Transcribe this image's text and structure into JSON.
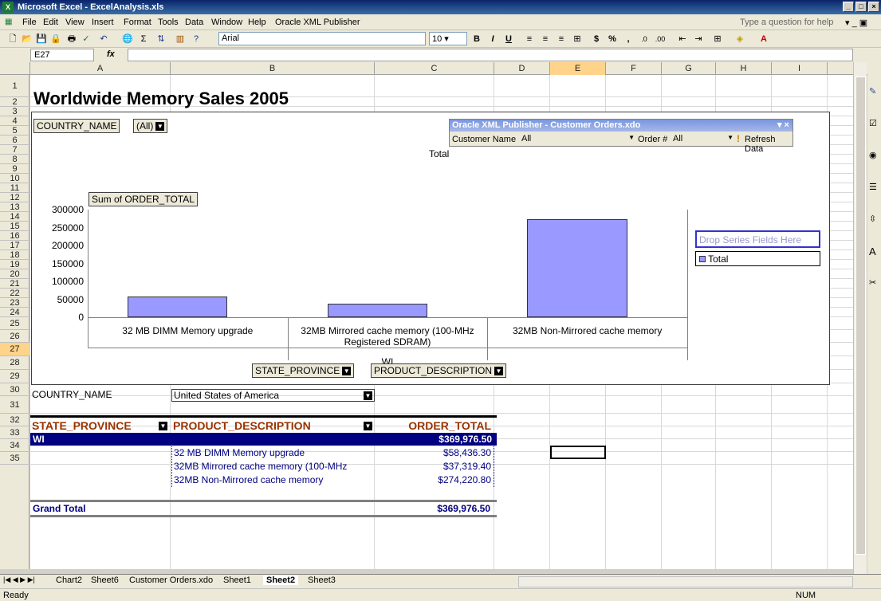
{
  "window": {
    "title": "Microsoft Excel - ExcelAnalysis.xls",
    "app_icon": "excel-icon",
    "minimize": "_",
    "maximize": "□",
    "close": "×"
  },
  "menu": {
    "items": [
      "File",
      "Edit",
      "View",
      "Insert",
      "Format",
      "Tools",
      "Data",
      "Window",
      "Help",
      "Oracle XML Publisher"
    ],
    "help_box": "Type a question for help"
  },
  "toolbar": {
    "font": "Arial",
    "size": "10",
    "bold": "B",
    "italic": "I",
    "underline": "U",
    "currency": "$",
    "percent": "%",
    "comma": ","
  },
  "formula": {
    "name_box": "E27",
    "fx": "fx",
    "value": ""
  },
  "columns": [
    "A",
    "B",
    "C",
    "D",
    "E",
    "F",
    "G",
    "H",
    "I"
  ],
  "rows": [
    "1",
    "2",
    "3",
    "4",
    "5",
    "6",
    "7",
    "8",
    "9",
    "10",
    "11",
    "12",
    "13",
    "14",
    "15",
    "16",
    "17",
    "18",
    "19",
    "20",
    "21",
    "22",
    "23",
    "24",
    "25",
    "26",
    "27",
    "28",
    "29",
    "30",
    "31",
    "32",
    "33",
    "34",
    "35"
  ],
  "sheet": {
    "title": "Worldwide Memory Sales 2005"
  },
  "pivot_chart": {
    "page_field": "COUNTRY_NAME",
    "page_value": "(All)",
    "data_field": "Sum of ORDER_TOTAL",
    "chart_title": "Total",
    "series_drop": "Drop Series Fields Here",
    "row_fields": [
      "STATE_PROVINCE",
      "PRODUCT_DESCRIPTION"
    ]
  },
  "chart_data": {
    "type": "bar",
    "title": "Total",
    "categories": [
      "32 MB DIMM Memory upgrade",
      "32MB Mirrored cache memory (100-MHz Registered SDRAM)",
      "32MB Non-Mirrored cache memory"
    ],
    "group_label": "WI",
    "series": [
      {
        "name": "Total",
        "values": [
          58436.3,
          37319.4,
          274220.8
        ]
      }
    ],
    "ylim": [
      0,
      300000
    ],
    "yticks": [
      "0",
      "50000",
      "100000",
      "150000",
      "200000",
      "250000",
      "300000"
    ],
    "legend": "right",
    "colors": {
      "bar": "#9999ff"
    }
  },
  "xmlpub": {
    "title": "Oracle XML Publisher - Customer Orders.xdo",
    "customer_label": "Customer Name",
    "customer_value": "All",
    "order_label": "Order #",
    "order_value": "All",
    "refresh": "Refresh Data"
  },
  "pivot_table": {
    "page_label": "COUNTRY_NAME",
    "page_value": "United States of America",
    "headers": [
      "STATE_PROVINCE",
      "PRODUCT_DESCRIPTION",
      "ORDER_TOTAL"
    ],
    "state": "WI",
    "state_total": "$369,976.50",
    "rows": [
      {
        "desc": "32 MB DIMM Memory upgrade",
        "total": "$58,436.30"
      },
      {
        "desc": "32MB Mirrored cache memory (100-MHz",
        "total": "$37,319.40"
      },
      {
        "desc": "32MB Non-Mirrored cache memory",
        "total": "$274,220.80"
      }
    ],
    "grand_label": "Grand Total",
    "grand_total": "$369,976.50",
    "colors": {
      "header_text": "#993300",
      "state_bg": "#000080",
      "detail_text": "#000080"
    }
  },
  "tabs": {
    "items": [
      "Chart2",
      "Sheet6",
      "Customer Orders.xdo",
      "Sheet1",
      "Sheet2",
      "Sheet3"
    ],
    "active": "Sheet2"
  },
  "status": {
    "left": "Ready",
    "right": "NUM"
  }
}
